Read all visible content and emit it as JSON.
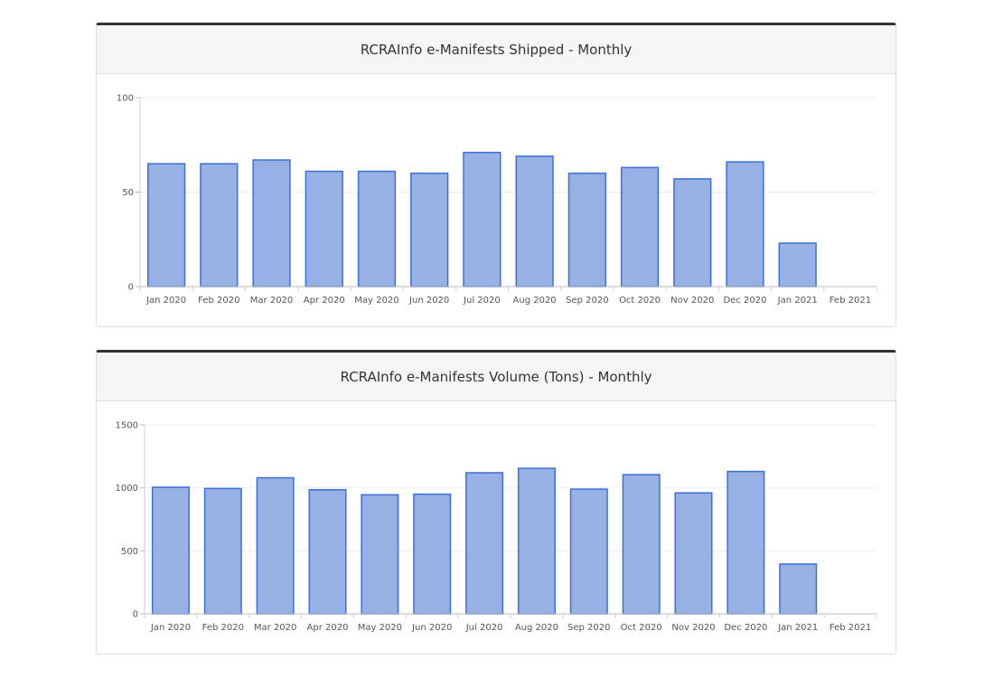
{
  "chart_data": [
    {
      "type": "bar",
      "title": "RCRAInfo e-Manifests Shipped - Monthly",
      "categories": [
        "Jan 2020",
        "Feb 2020",
        "Mar 2020",
        "Apr 2020",
        "May 2020",
        "Jun 2020",
        "Jul 2020",
        "Aug 2020",
        "Sep 2020",
        "Oct 2020",
        "Nov 2020",
        "Dec 2020",
        "Jan 2021",
        "Feb 2021"
      ],
      "values": [
        65,
        65,
        67,
        61,
        61,
        60,
        71,
        69,
        60,
        63,
        57,
        66,
        23,
        0
      ],
      "ylim": [
        0,
        100
      ],
      "yticks": [
        0,
        50,
        100
      ],
      "grid": true,
      "colors": {
        "bar_fill": "#97b1e4",
        "bar_stroke": "#3c6fd6"
      }
    },
    {
      "type": "bar",
      "title": "RCRAInfo e-Manifests Volume (Tons) - Monthly",
      "categories": [
        "Jan 2020",
        "Feb 2020",
        "Mar 2020",
        "Apr 2020",
        "May 2020",
        "Jun 2020",
        "Jul 2020",
        "Aug 2020",
        "Sep 2020",
        "Oct 2020",
        "Nov 2020",
        "Dec 2020",
        "Jan 2021",
        "Feb 2021"
      ],
      "values": [
        1005,
        995,
        1080,
        985,
        945,
        950,
        1120,
        1155,
        990,
        1105,
        960,
        1130,
        395,
        0
      ],
      "ylim": [
        0,
        1500
      ],
      "yticks": [
        0,
        500,
        1000,
        1500
      ],
      "grid": true,
      "colors": {
        "bar_fill": "#97b1e4",
        "bar_stroke": "#3c6fd6"
      }
    }
  ]
}
